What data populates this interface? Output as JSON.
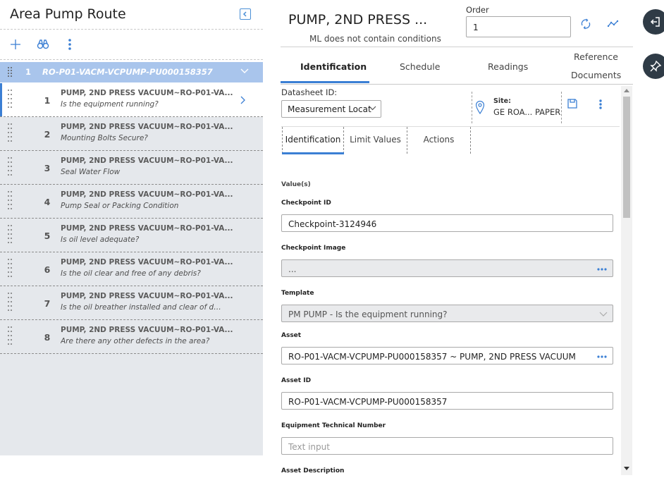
{
  "left": {
    "title": "Area Pump Route",
    "route": {
      "number": "1",
      "label": "RO-P01-VACM-VCPUMP-PU000158357"
    },
    "items": [
      {
        "num": "1",
        "title": "PUMP, 2ND PRESS VACUUM~RO-P01-VA...",
        "sub": "Is the equipment running?",
        "selected": true
      },
      {
        "num": "2",
        "title": "PUMP, 2ND PRESS VACUUM~RO-P01-VA...",
        "sub": "Mounting Bolts Secure?"
      },
      {
        "num": "3",
        "title": "PUMP, 2ND PRESS VACUUM~RO-P01-VA...",
        "sub": "Seal Water Flow"
      },
      {
        "num": "4",
        "title": "PUMP, 2ND PRESS VACUUM~RO-P01-VA...",
        "sub": "Pump Seal or Packing Condition"
      },
      {
        "num": "5",
        "title": "PUMP, 2ND PRESS VACUUM~RO-P01-VA...",
        "sub": "Is oil level adequate?"
      },
      {
        "num": "6",
        "title": "PUMP, 2ND PRESS VACUUM~RO-P01-VA...",
        "sub": "Is the oil clear and free of any debris?"
      },
      {
        "num": "7",
        "title": "PUMP, 2ND PRESS VACUUM~RO-P01-VA...",
        "sub": "Is the oil breather installed and clear of debri..."
      },
      {
        "num": "8",
        "title": "PUMP, 2ND PRESS VACUUM~RO-P01-VA...",
        "sub": "Are there any other defects in the area?"
      }
    ]
  },
  "header": {
    "title": "PUMP, 2ND PRESS ...",
    "ml_text": "ML does not contain conditions",
    "order_label": "Order",
    "order_value": "1"
  },
  "tabs": {
    "identification": "Identification",
    "schedule": "Schedule",
    "readings": "Readings",
    "reference_line1": "Reference",
    "reference_line2": "Documents"
  },
  "datasheet": {
    "label": "Datasheet ID:",
    "value": "Measurement Locat",
    "site_label": "Site:",
    "site_value": "GE ROA... PAPER"
  },
  "subtabs": {
    "identification": "Identification",
    "limit_values": "Limit Values",
    "actions": "Actions"
  },
  "form": {
    "values_label": "Value(s)",
    "checkpoint_id_label": "Checkpoint ID",
    "checkpoint_id_value": "Checkpoint-3124946",
    "checkpoint_image_label": "Checkpoint Image",
    "checkpoint_image_value": "...",
    "template_label": "Template",
    "template_value": "PM PUMP - Is the equipment running?",
    "asset_label": "Asset",
    "asset_value": "RO-P01-VACM-VCPUMP-PU000158357 ~ PUMP, 2ND PRESS VACUUM",
    "asset_id_label": "Asset ID",
    "asset_id_value": "RO-P01-VACM-VCPUMP-PU000158357",
    "etn_label": "Equipment Technical Number",
    "etn_placeholder": "Text input",
    "asset_desc_label": "Asset Description"
  },
  "colors": {
    "accent": "#3b7fd4",
    "route_header_bg": "#a9c5ec",
    "list_bg": "#e5e8ec",
    "side_button_bg": "#2f3b46"
  }
}
